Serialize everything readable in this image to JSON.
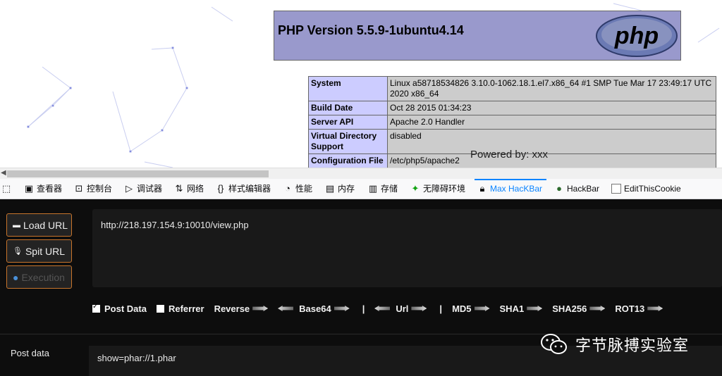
{
  "page": {
    "php_version": "PHP Version 5.5.9-1ubuntu4.14",
    "logo_text": "php",
    "info_rows": [
      {
        "key": "System",
        "value": "Linux a58718534826 3.10.0-1062.18.1.el7.x86_64 #1 SMP Tue Mar 17 23:49:17 UTC 2020 x86_64"
      },
      {
        "key": "Build Date",
        "value": "Oct 28 2015 01:34:23"
      },
      {
        "key": "Server API",
        "value": "Apache 2.0 Handler"
      },
      {
        "key": "Virtual Directory Support",
        "value": "disabled"
      },
      {
        "key": "Configuration File",
        "value": "/etc/php5/apache2"
      }
    ],
    "powered_by": "Powered by: xxx"
  },
  "devtools": {
    "tabs": [
      {
        "label": "查看器",
        "icon": "inspector-icon"
      },
      {
        "label": "控制台",
        "icon": "console-icon"
      },
      {
        "label": "调试器",
        "icon": "debugger-icon"
      },
      {
        "label": "网络",
        "icon": "network-icon"
      },
      {
        "label": "样式编辑器",
        "icon": "style-editor-icon"
      },
      {
        "label": "性能",
        "icon": "performance-icon"
      },
      {
        "label": "内存",
        "icon": "memory-icon"
      },
      {
        "label": "存储",
        "icon": "storage-icon"
      },
      {
        "label": "无障碍环境",
        "icon": "accessibility-icon"
      },
      {
        "label": "Max HacKBar",
        "icon": "hackbar-lock-icon"
      },
      {
        "label": "HackBar",
        "icon": "hackbar-icon"
      },
      {
        "label": "EditThisCookie",
        "icon": "cookie-icon"
      }
    ],
    "active_tab": "Max HacKBar",
    "accent": "#0a84ff"
  },
  "hackbar": {
    "buttons": {
      "load": "Load URL",
      "split": "Spit URL",
      "execute": "Execution"
    },
    "url": "http://218.197.154.9:10010/view.php",
    "options": {
      "post_data": "Post Data",
      "post_data_checked": true,
      "referrer": "Referrer",
      "referrer_checked": false,
      "reverse": "Reverse",
      "base64": "Base64",
      "sep1": "|",
      "url": "Url",
      "sep2": "|",
      "md5": "MD5",
      "sha1": "SHA1",
      "sha256": "SHA256",
      "rot13": "ROT13"
    },
    "post_label": "Post data",
    "post_value": "show=phar://1.phar",
    "border_color": "#c8752c"
  },
  "watermark": {
    "text": "字节脉搏实验室"
  }
}
